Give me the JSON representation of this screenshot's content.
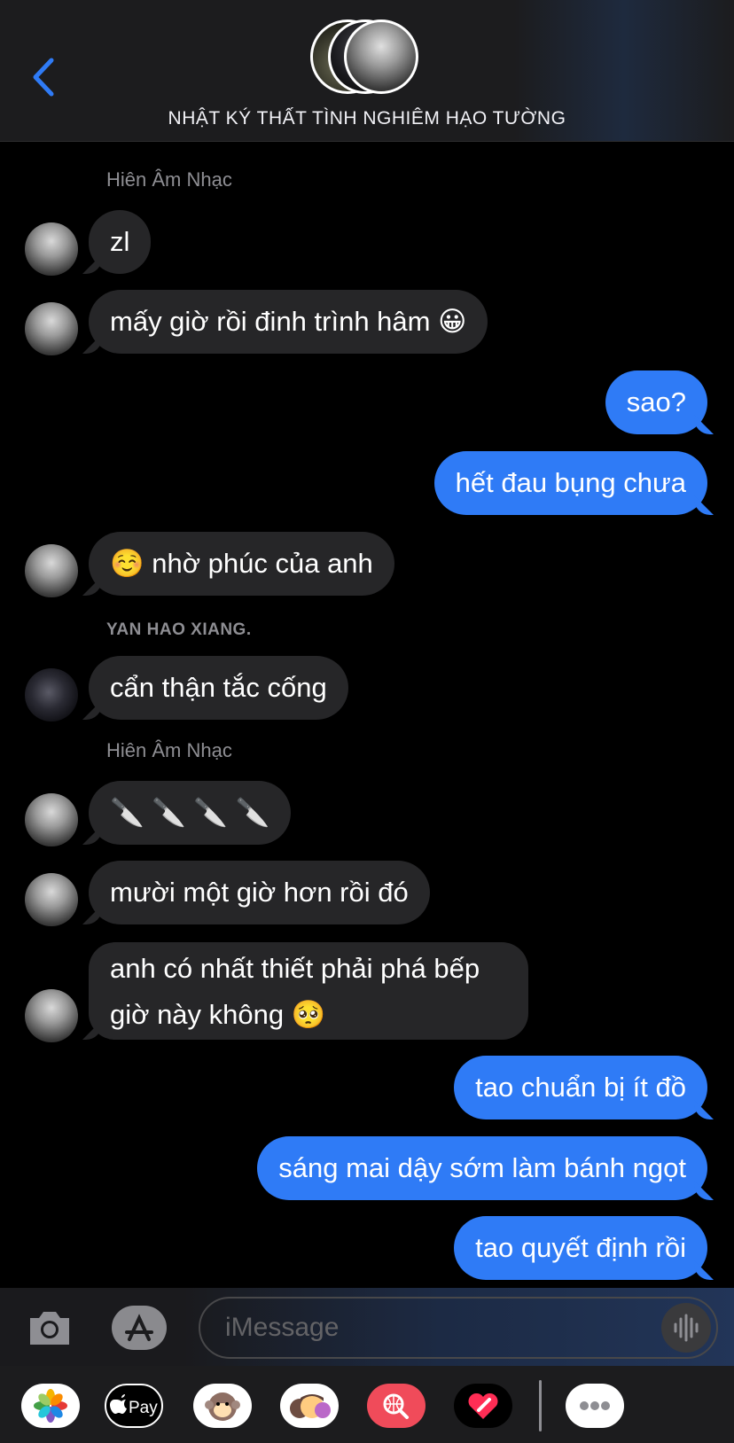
{
  "header": {
    "title": "NHẬT KÝ THẤT TÌNH NGHIÊM HẠO TƯỜNG",
    "back_icon": "chevron-left-icon"
  },
  "messages": [
    {
      "type": "sender",
      "text": "Hiên Âm Nhạc"
    },
    {
      "type": "incoming",
      "text": "zl"
    },
    {
      "type": "incoming",
      "text": "mấy giờ rồi đinh trình hâm 😀"
    },
    {
      "type": "outgoing",
      "text": "sao?"
    },
    {
      "type": "outgoing",
      "text": "hết đau bụng chưa"
    },
    {
      "type": "incoming",
      "text": "☺️ nhờ phúc của anh"
    },
    {
      "type": "sender",
      "text": "YAN HAO XIANG."
    },
    {
      "type": "incoming",
      "text": "cẩn thận tắc cống"
    },
    {
      "type": "sender",
      "text": "Hiên Âm Nhạc"
    },
    {
      "type": "incoming",
      "text": "🔪 🔪 🔪 🔪"
    },
    {
      "type": "incoming",
      "text": "mười một giờ hơn rồi đó"
    },
    {
      "type": "incoming",
      "text": "anh có nhất thiết phải phá bếp giờ này không 🥺"
    },
    {
      "type": "outgoing",
      "text": "tao chuẩn bị ít đồ"
    },
    {
      "type": "outgoing",
      "text": "sáng mai dậy sớm làm bánh ngọt"
    },
    {
      "type": "outgoing",
      "text": "tao quyết định rồi"
    }
  ],
  "input": {
    "placeholder": "iMessage"
  },
  "app_drawer": [
    "photos-icon",
    "apple-pay-icon",
    "animoji-icon",
    "memoji-icon",
    "image-search-icon",
    "digital-touch-icon",
    "more-icon"
  ],
  "colors": {
    "outgoing_bubble": "#2f7bf6",
    "incoming_bubble": "#262628",
    "accent": "#2f7bf6"
  },
  "apple_pay_label": "Pay"
}
